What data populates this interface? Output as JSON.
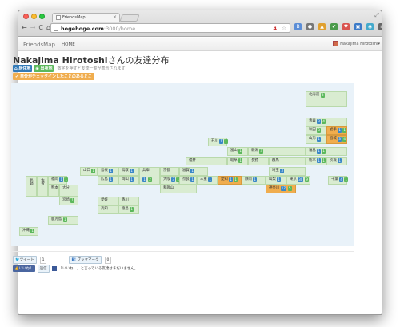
{
  "browser": {
    "tab_title": "FriendsMap",
    "tab_close": "×",
    "resize_icon": "⤢",
    "nav": {
      "back": "←",
      "forward": "→",
      "reload": "C",
      "home": "⌂"
    },
    "url_host": "hogehoge.com",
    "url_path": ":3000/home",
    "toolbar_icons": [
      {
        "name": "bookmark-star-icon",
        "glyph": "☆",
        "color": "#999999"
      },
      {
        "name": "extension-icon",
        "glyph": "B",
        "color": "#5b8dd6"
      },
      {
        "name": "extension-icon",
        "glyph": "●",
        "color": "#777777"
      },
      {
        "name": "extension-icon",
        "glyph": "▲",
        "color": "#e0a030"
      },
      {
        "name": "extension-icon",
        "glyph": "✔",
        "color": "#4a9a4a"
      },
      {
        "name": "extension-icon",
        "glyph": "♥",
        "color": "#d9534f"
      },
      {
        "name": "extension-icon",
        "glyph": "▣",
        "color": "#3b7ac8"
      },
      {
        "name": "extension-icon",
        "glyph": "◉",
        "color": "#44aacc"
      },
      {
        "name": "menu-icon",
        "glyph": "≡",
        "color": "#666666"
      }
    ],
    "url_extra": "4"
  },
  "topnav": {
    "brand": "FriendsMap",
    "home": "HOME",
    "user": "Nakajima Hirotoshi▾"
  },
  "page": {
    "title_name": "Nakajima Hirotoshi",
    "title_suffix": "さんの友達分布",
    "label_home": "居住地",
    "label_hometown": "出身地",
    "hint": "数字を押すと友達一覧が表示されます",
    "checkin_label": "自分がチェックインしたことのあるとこ"
  },
  "colors": {
    "home": "#337ab7",
    "hometown": "#5cb85c",
    "checkin": "#f0ad4e",
    "badge_blue": "#3a87c7",
    "badge_green": "#5cb85c"
  },
  "map": {
    "prefectures": [
      {
        "name": "北海道",
        "badges": [
          {
            "v": "3",
            "c": "g"
          }
        ]
      },
      {
        "name": "青森",
        "badges": [
          {
            "v": "3",
            "c": "b"
          },
          {
            "v": "4",
            "c": "g"
          }
        ]
      },
      {
        "name": "秋田",
        "badges": [
          {
            "v": "3",
            "c": "g"
          }
        ]
      },
      {
        "name": "岩手",
        "badges": [
          {
            "v": "1",
            "c": "b"
          },
          {
            "v": "1",
            "c": "g"
          }
        ],
        "hot": true
      },
      {
        "name": "山形",
        "badges": [
          {
            "v": "1",
            "c": "b"
          }
        ]
      },
      {
        "name": "宮城",
        "badges": [
          {
            "v": "3",
            "c": "b"
          },
          {
            "v": "4",
            "c": "g"
          }
        ],
        "hot": true
      },
      {
        "name": "石川",
        "badges": [
          {
            "v": "1",
            "c": "b"
          },
          {
            "v": "1",
            "c": "g"
          }
        ]
      },
      {
        "name": "富山",
        "badges": [
          {
            "v": "1",
            "c": "g"
          }
        ]
      },
      {
        "name": "新潟",
        "badges": [
          {
            "v": "3",
            "c": "g"
          }
        ]
      },
      {
        "name": "福島",
        "badges": [
          {
            "v": "1",
            "c": "b"
          },
          {
            "v": "1",
            "c": "g"
          }
        ]
      },
      {
        "name": "福井",
        "badges": []
      },
      {
        "name": "岐阜",
        "badges": [
          {
            "v": "1",
            "c": "g"
          }
        ]
      },
      {
        "name": "長野",
        "badges": []
      },
      {
        "name": "群馬",
        "badges": []
      },
      {
        "name": "栃木",
        "badges": [
          {
            "v": "1",
            "c": "b"
          },
          {
            "v": "1",
            "c": "g"
          }
        ]
      },
      {
        "name": "茨城",
        "badges": [
          {
            "v": "1",
            "c": "b"
          }
        ]
      },
      {
        "name": "山口",
        "badges": [
          {
            "v": "1",
            "c": "g"
          }
        ]
      },
      {
        "name": "島根",
        "badges": [
          {
            "v": "1",
            "c": "b"
          }
        ]
      },
      {
        "name": "鳥取",
        "badges": [
          {
            "v": "1",
            "c": "b"
          }
        ]
      },
      {
        "name": "兵庫",
        "badges": [
          {
            "v": "1",
            "c": "b"
          },
          {
            "v": "2",
            "c": "g"
          }
        ]
      },
      {
        "name": "京都",
        "badges": []
      },
      {
        "name": "滋賀",
        "badges": [
          {
            "v": "1",
            "c": "b"
          }
        ]
      },
      {
        "name": "埼玉",
        "badges": [
          {
            "v": "3",
            "c": "b"
          }
        ]
      },
      {
        "name": "長崎",
        "badges": []
      },
      {
        "name": "佐賀",
        "badges": []
      },
      {
        "name": "福岡",
        "badges": [
          {
            "v": "1",
            "c": "b"
          },
          {
            "v": "1",
            "c": "g"
          }
        ]
      },
      {
        "name": "広島",
        "badges": [
          {
            "v": "1",
            "c": "b"
          }
        ]
      },
      {
        "name": "岡山",
        "badges": [
          {
            "v": "1",
            "c": "b"
          }
        ]
      },
      {
        "name": "大阪",
        "badges": [
          {
            "v": "3",
            "c": "b"
          },
          {
            "v": "1",
            "c": "g"
          }
        ]
      },
      {
        "name": "奈良",
        "badges": [
          {
            "v": "1",
            "c": "b"
          }
        ]
      },
      {
        "name": "三重",
        "badges": [
          {
            "v": "1",
            "c": "b"
          }
        ]
      },
      {
        "name": "愛知",
        "badges": [
          {
            "v": "1",
            "c": "b"
          },
          {
            "v": "1",
            "c": "g"
          }
        ],
        "hot": true
      },
      {
        "name": "静岡",
        "badges": [
          {
            "v": "1",
            "c": "b"
          }
        ]
      },
      {
        "name": "山梨",
        "badges": [
          {
            "v": "1",
            "c": "b"
          }
        ]
      },
      {
        "name": "東京",
        "badges": [
          {
            "v": "30",
            "c": "b"
          },
          {
            "v": "9",
            "c": "g"
          }
        ]
      },
      {
        "name": "千葉",
        "badges": [
          {
            "v": "4",
            "c": "b"
          },
          {
            "v": "1",
            "c": "g"
          }
        ]
      },
      {
        "name": "熊本",
        "badges": []
      },
      {
        "name": "大分",
        "badges": []
      },
      {
        "name": "和歌山",
        "badges": []
      },
      {
        "name": "神奈川",
        "badges": [
          {
            "v": "17",
            "c": "b"
          },
          {
            "v": "5",
            "c": "g"
          }
        ],
        "hot": true
      },
      {
        "name": "宮崎",
        "badges": [
          {
            "v": "1",
            "c": "g"
          }
        ]
      },
      {
        "name": "愛媛",
        "badges": []
      },
      {
        "name": "香川",
        "badges": []
      },
      {
        "name": "高知",
        "badges": []
      },
      {
        "name": "徳島",
        "badges": [
          {
            "v": "1",
            "c": "g"
          }
        ]
      },
      {
        "name": "鹿児島",
        "badges": [
          {
            "v": "1",
            "c": "g"
          }
        ]
      },
      {
        "name": "沖縄",
        "badges": [
          {
            "v": "1",
            "c": "g"
          }
        ]
      }
    ]
  },
  "share": {
    "tweet": "ツイート",
    "tweet_count": "1",
    "hatena": "ブックマーク",
    "hatena_count": "0",
    "like": "いいね！",
    "send": "送信",
    "fb_text": "「いいね！」と言っている友達はまだいません。"
  }
}
